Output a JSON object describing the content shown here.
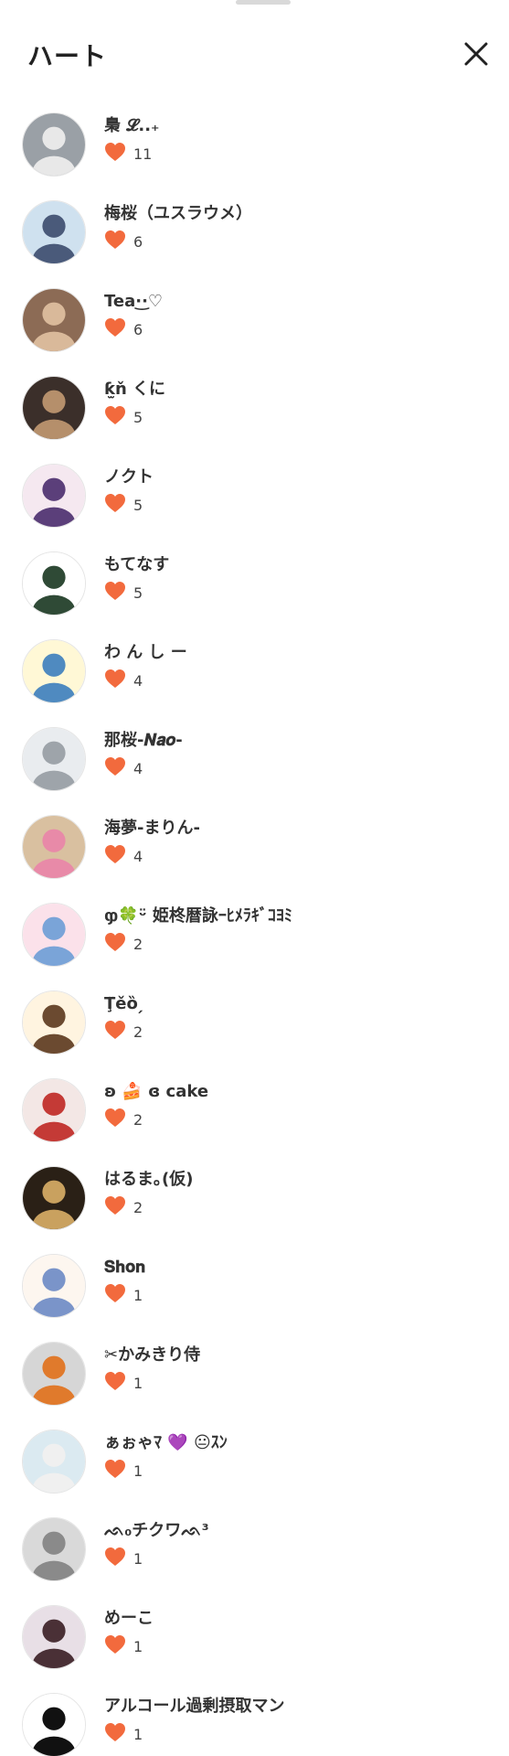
{
  "header": {
    "title": "ハート",
    "close_icon": "close-icon"
  },
  "accent_heart_color": "#f26a3d",
  "users": [
    {
      "name": "梟 𝓛..₊",
      "likes": "11",
      "avatar_bg": "#9aa0a6",
      "avatar_fg": "#e8e8e8"
    },
    {
      "name": "梅桜（ユスラウメ）",
      "likes": "6",
      "avatar_bg": "#cfe1ef",
      "avatar_fg": "#4a5a7a"
    },
    {
      "name": "Tea·͜·♡",
      "likes": "6",
      "avatar_bg": "#8c6b55",
      "avatar_fg": "#d9b99a"
    },
    {
      "name": "ƙ̫ň くに",
      "likes": "5",
      "avatar_bg": "#3b2f2a",
      "avatar_fg": "#b58f6b"
    },
    {
      "name": "ノクト",
      "likes": "5",
      "avatar_bg": "#f5e8f0",
      "avatar_fg": "#5b3f7a"
    },
    {
      "name": "もてなす",
      "likes": "5",
      "avatar_bg": "#ffffff",
      "avatar_fg": "#2f4a36"
    },
    {
      "name": "わ ん し ー",
      "likes": "4",
      "avatar_bg": "#fff8d6",
      "avatar_fg": "#4f8ac0"
    },
    {
      "name": "那桜-𝑵𝒂𝒐-",
      "likes": "4",
      "avatar_bg": "#e9ecef",
      "avatar_fg": "#9ea4aa"
    },
    {
      "name": "海夢-まりん-",
      "likes": "4",
      "avatar_bg": "#d9c0a0",
      "avatar_fg": "#e88aa8"
    },
    {
      "name": "ჶ🍀ᵕ̈ 姫柊暦詠ｰﾋﾒﾗｷﾞｺﾖﾐ",
      "likes": "2",
      "avatar_bg": "#fbe1ea",
      "avatar_fg": "#7aa4d8"
    },
    {
      "name": "Ţ̈ěȍ ̗",
      "likes": "2",
      "avatar_bg": "#fff4e0",
      "avatar_fg": "#6b4a30"
    },
    {
      "name": "ʚ 🍰 ɞ cake",
      "likes": "2",
      "avatar_bg": "#f3e7e5",
      "avatar_fg": "#c43a36"
    },
    {
      "name": "はるま｡(仮)",
      "likes": "2",
      "avatar_bg": "#2a2016",
      "avatar_fg": "#c9a15f"
    },
    {
      "name": "𝐒𝐡𝐨𝐧",
      "likes": "1",
      "avatar_bg": "#fdf6ef",
      "avatar_fg": "#7a94c9"
    },
    {
      "name": "✂かみきり侍",
      "likes": "1",
      "avatar_bg": "#d6d6d6",
      "avatar_fg": "#e07a2c"
    },
    {
      "name": "ぁぉゃﾏ 💜 😐ｽﾝ",
      "likes": "1",
      "avatar_bg": "#dbeaf1",
      "avatar_fg": "#f0f0f0"
    },
    {
      "name": "ᨒ₀チクワᨒ³",
      "likes": "1",
      "avatar_bg": "#d9d9d9",
      "avatar_fg": "#8a8a8a"
    },
    {
      "name": "めーこ",
      "likes": "1",
      "avatar_bg": "#e8dfe6",
      "avatar_fg": "#4a3036"
    },
    {
      "name": "アルコール過剰摂取マン",
      "likes": "1",
      "avatar_bg": "#ffffff",
      "avatar_fg": "#111111"
    }
  ]
}
